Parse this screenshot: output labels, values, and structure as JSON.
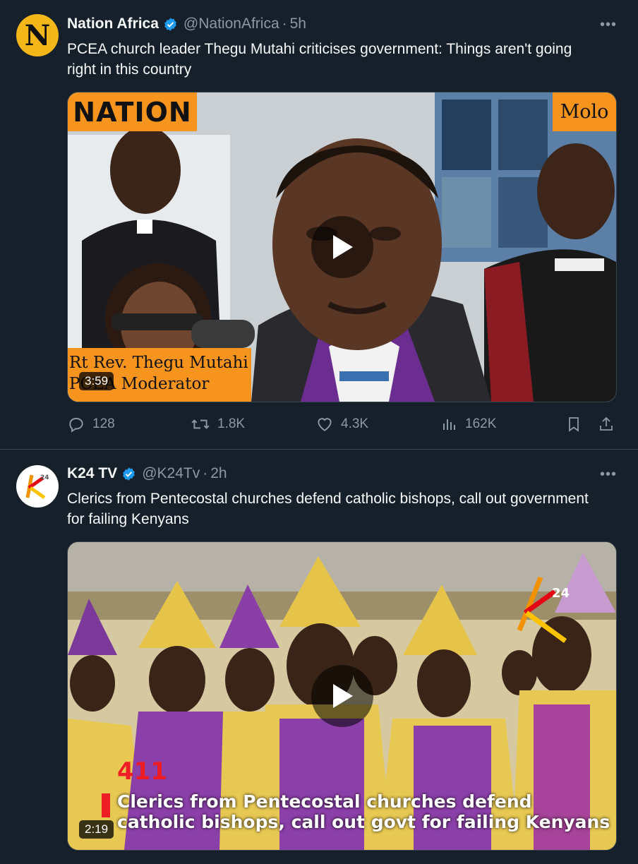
{
  "tweets": [
    {
      "author": "Nation Africa",
      "handle": "@NationAfrica",
      "time": "5h",
      "avatar_letter": "N",
      "text": "PCEA church leader Thegu Mutahi criticises government: Things aren't going right in this country",
      "media": {
        "brand": "NATION",
        "location_tag": "Molo",
        "caption_line1": "Rt Rev. Thegu Mutahi",
        "caption_line2": "PCEA Moderator",
        "duration": "3:59"
      },
      "stats": {
        "replies": "128",
        "reposts": "1.8K",
        "likes": "4.3K",
        "views": "162K"
      }
    },
    {
      "author": "K24 TV",
      "handle": "@K24Tv",
      "time": "2h",
      "text": "Clerics from Pentecostal churches defend catholic bishops, call out government for failing Kenyans",
      "media": {
        "number": "411",
        "headline_line1": "Clerics from Pentecostal churches defend",
        "headline_line2": "catholic bishops, call out govt for failing Kenyans",
        "duration": "2:19"
      }
    }
  ],
  "more_label": "•••",
  "colors": {
    "background": "#15202b",
    "secondary_text": "#8b98a5",
    "verified": "#1d9bf0",
    "nation_orange": "#f7941d"
  }
}
